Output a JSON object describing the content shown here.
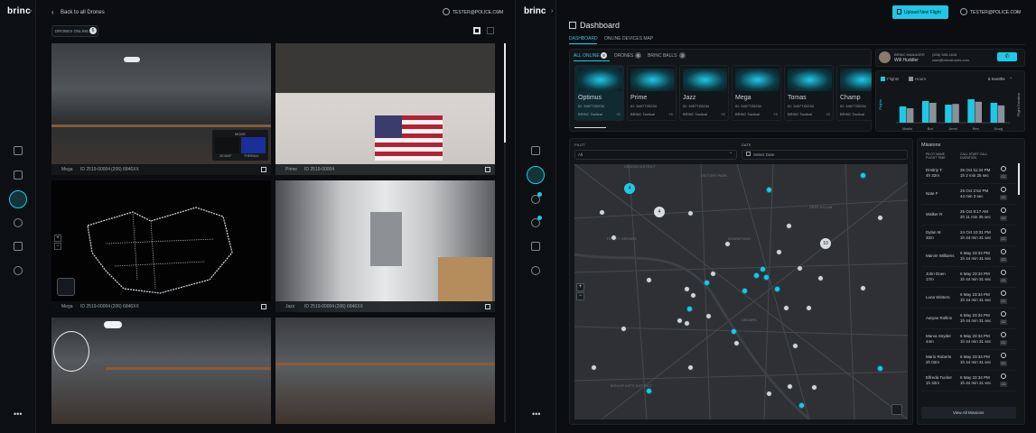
{
  "left": {
    "logo": "brinc",
    "back_label": "Back to all Drones",
    "user_email": "TESTER@POLICE.COM",
    "drones_online_label": "DRONES ONLINE",
    "drones_online_count": "6",
    "tiles": [
      {
        "name": "Mega",
        "id": "ID 2519-00004",
        "phone": "(206) 6846XX",
        "panel_title": "MODE",
        "panel_a": "3D MAP",
        "panel_b": "THERMAL"
      },
      {
        "name": "Prime",
        "id": "ID 2519-00004",
        "phone": ""
      },
      {
        "name": "Mega",
        "id": "ID 2519-00004",
        "phone": "(206) 6846XX"
      },
      {
        "name": "Jazz",
        "id": "ID 2519-00004",
        "phone": "(206) 6846XX"
      },
      {
        "name": "",
        "id": "",
        "phone": ""
      },
      {
        "name": "",
        "id": "",
        "phone": ""
      }
    ]
  },
  "right": {
    "logo": "brinc",
    "title": "Dashboard",
    "upload_label": "Upload New Flight",
    "user_email": "TESTER@POLICE.COM",
    "tabs": [
      "DASHBOARD",
      "ONLINE DEVICES MAP"
    ],
    "subtabs": [
      {
        "label": "ALL ONLINE",
        "count": "9"
      },
      {
        "label": "DRONES",
        "count": "6"
      },
      {
        "label": "BRINC BALLS",
        "count": "3"
      }
    ],
    "drones": [
      {
        "name": "Optimus",
        "id": "ID: 3457TZ0234",
        "tag": "BRINC Tactical",
        "extra": "+3"
      },
      {
        "name": "Prime",
        "id": "ID: 3457TZ0234",
        "tag": "BRINC Tactical",
        "extra": "+3"
      },
      {
        "name": "Jazz",
        "id": "ID: 3457TZ0234",
        "tag": "BRINC Tactical",
        "extra": "+3"
      },
      {
        "name": "Mega",
        "id": "ID: 3457TZ0234",
        "tag": "BRINC Tactical",
        "extra": "+3"
      },
      {
        "name": "Tomas",
        "id": "ID: 3457TZ0234",
        "tag": "BRINC Tactical",
        "extra": "+3"
      },
      {
        "name": "Champ",
        "id": "ID: 3457TZ0234",
        "tag": "BRINC Tactical",
        "extra": "+3"
      }
    ],
    "contact": {
      "role": "BRINC MANAGER",
      "name": "Will Huddler",
      "phone": "(206) 555-1616",
      "email": "csm@brincdrones.com"
    },
    "chart_legend": [
      "Flights",
      "Hours"
    ],
    "chart_range": "6 months",
    "filters": {
      "pilot_label": "PILOT",
      "pilot_value": "All",
      "date_label": "DATE",
      "date_value": "Select Date"
    },
    "map_labels": [
      "DESIGN DISTRICT",
      "VICTORY PARK",
      "DEEP ELLUM",
      "DOWNTOWN",
      "CEDARS",
      "BISHOP ARTS DISTRICT",
      "TRINITY GROVES"
    ],
    "clusters": [
      "4",
      "4",
      "10"
    ],
    "missions_title": "Missions",
    "missions_headers": [
      "PILOT NAME FLIGHT TIME",
      "CALL START CALL DURATION",
      ""
    ],
    "missions": [
      {
        "pilot": "Dmitriy T.",
        "time": "4h 32m",
        "start": "25 Oct 11:34 PM",
        "dur": "1h 2 min 25 sec"
      },
      {
        "pilot": "Nate F",
        "time": "",
        "start": "25 Oct 2:52 PM",
        "dur": "44 min 3 sec"
      },
      {
        "pilot": "Walker R",
        "time": "",
        "start": "25 Oct 8:17 AM",
        "dur": "2h 11 min 35 sec"
      },
      {
        "pilot": "Dylan M",
        "time": "32m",
        "start": "24 Oct 10:31 PM",
        "dur": "1h 44 min 31 sec"
      },
      {
        "pilot": "Marvin Williams",
        "time": "",
        "start": "6 May 23:34 PM",
        "dur": "1h 44 min 31 sec"
      },
      {
        "pilot": "John Doen",
        "time": "17m",
        "start": "6 May 23:34 PM",
        "dur": "1h 44 min 31 sec"
      },
      {
        "pilot": "Luna Winters",
        "time": "",
        "start": "6 May 23:34 PM",
        "dur": "1h 44 min 31 sec"
      },
      {
        "pilot": "Aaryan Rollins",
        "time": "",
        "start": "6 May 23:34 PM",
        "dur": "1h 44 min 31 sec"
      },
      {
        "pilot": "Marva Snyder",
        "time": "44m",
        "start": "6 May 23:34 PM",
        "dur": "1h 44 min 31 sec"
      },
      {
        "pilot": "Mario Roberts",
        "time": "2h 02m",
        "start": "6 May 23:34 PM",
        "dur": "1h 44 min 31 sec"
      },
      {
        "pilot": "Elfreda Tucker",
        "time": "1h 32m",
        "start": "6 May 23:34 PM",
        "dur": "1h 44 min 31 sec"
      }
    ],
    "view_all_label": "View All Missions",
    "cc_label": "CC"
  },
  "chart_data": {
    "type": "bar",
    "categories": [
      "Marlin",
      "Bot",
      "Jenni",
      "Rex",
      "Doug"
    ],
    "series": [
      {
        "name": "Flights",
        "values": [
          45,
          60,
          50,
          65,
          55
        ]
      },
      {
        "name": "Hours",
        "values": [
          40,
          55,
          52,
          58,
          48
        ]
      }
    ],
    "ylabel": "Flights",
    "y2label": "Flight Duration",
    "ylim": [
      0,
      100
    ],
    "colors": [
      "#1fc8e6",
      "#8a9299"
    ]
  },
  "colors": {
    "accent": "#1fc8e6",
    "bg": "#0b0d10"
  }
}
